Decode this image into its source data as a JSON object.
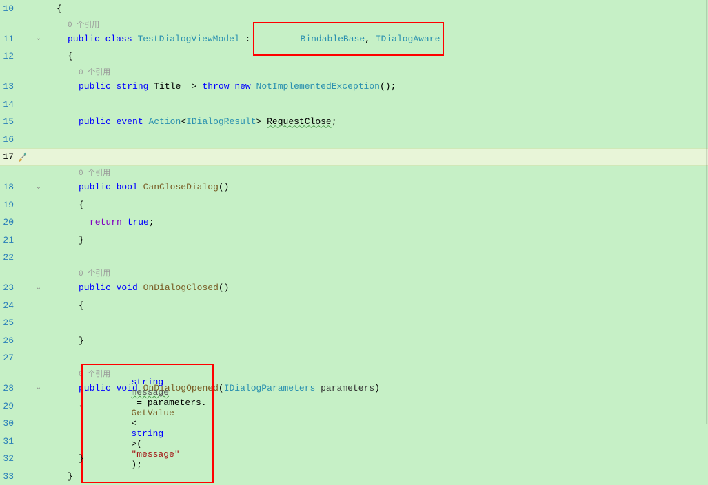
{
  "codelens": {
    "refs": "0 个引用"
  },
  "lines": {
    "l10": {
      "num": "10",
      "brace": "{"
    },
    "l10a": {
      "ref": "0 个引用"
    },
    "l11": {
      "num": "11",
      "kw_public": "public",
      "kw_class": "class",
      "classname": "TestDialogViewModel",
      "colon": " : ",
      "base": "BindableBase",
      "comma": ", ",
      "iface": "IDialogAware"
    },
    "l12": {
      "num": "12",
      "brace": "{"
    },
    "l12a": {
      "ref": "0 个引用"
    },
    "l13": {
      "num": "13",
      "kw_public": "public",
      "kw_string": "string",
      "title": "Title",
      "arrow": " => ",
      "kw_throw": "throw",
      "kw_new": "new",
      "exc": "NotImplementedException",
      "parens": "();"
    },
    "l14": {
      "num": "14"
    },
    "l15": {
      "num": "15",
      "kw_public": "public",
      "kw_event": "event",
      "action": "Action",
      "lt": "<",
      "idr": "IDialogResult",
      "gt": "> ",
      "rc": "RequestClose",
      "semi": ";"
    },
    "l16": {
      "num": "16"
    },
    "l17": {
      "num": "17"
    },
    "l17a": {
      "ref": "0 个引用"
    },
    "l18": {
      "num": "18",
      "kw_public": "public",
      "kw_bool": "bool",
      "method": "CanCloseDialog",
      "parens": "()"
    },
    "l19": {
      "num": "19",
      "brace": "{"
    },
    "l20": {
      "num": "20",
      "kw_return": "return",
      "kw_true": "true",
      "semi": ";"
    },
    "l21": {
      "num": "21",
      "brace": "}"
    },
    "l22": {
      "num": "22"
    },
    "l22a": {
      "ref": "0 个引用"
    },
    "l23": {
      "num": "23",
      "kw_public": "public",
      "kw_void": "void",
      "method": "OnDialogClosed",
      "parens": "()"
    },
    "l24": {
      "num": "24",
      "brace": "{"
    },
    "l25": {
      "num": "25"
    },
    "l26": {
      "num": "26",
      "brace": "}"
    },
    "l27": {
      "num": "27"
    },
    "l27a": {
      "ref": "0 个引用"
    },
    "l28": {
      "num": "28",
      "kw_public": "public",
      "kw_void": "void",
      "method": "OnDialogOpened",
      "paren_open": "(",
      "ptype": "IDialogParameters",
      "pname": " parameters",
      "paren_close": ")"
    },
    "l29": {
      "num": "29",
      "brace": "{"
    },
    "l30": {
      "num": "30",
      "kw_string": "string",
      "var": "message",
      "eq": " = parameters.",
      "gv": "GetValue",
      "lt": "<",
      "kw_string2": "string",
      "gt": ">(",
      "strlit": "\"message\"",
      "close": ");"
    },
    "l31": {
      "num": "31"
    },
    "l32": {
      "num": "32",
      "brace": "}"
    },
    "l33": {
      "num": "33",
      "brace": "}"
    }
  }
}
